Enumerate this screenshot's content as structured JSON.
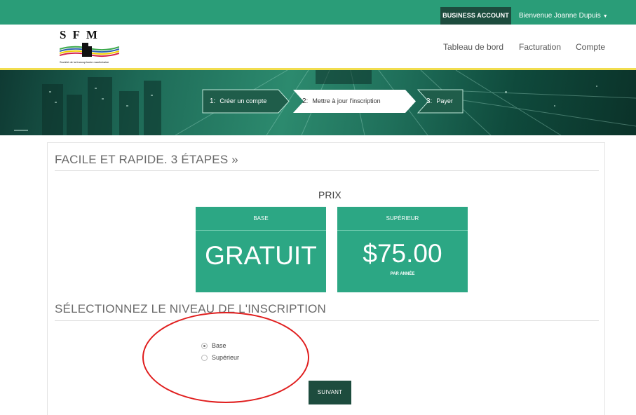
{
  "topbar": {
    "business_account": "BUSINESS ACCOUNT",
    "welcome": "Bienvenue Joanne Dupuis",
    "caret": "▼"
  },
  "logo": {
    "letters": "SFM",
    "subtitle": "Société de la francophonie manitobaine"
  },
  "nav": {
    "dashboard": "Tableau de bord",
    "billing": "Facturation",
    "account": "Compte"
  },
  "steps": [
    {
      "num": "1:",
      "label": "Créer un compte"
    },
    {
      "num": "2:",
      "label": "Mettre à jour l'inscription"
    },
    {
      "num": "3:",
      "label": "Payer"
    }
  ],
  "main": {
    "heading": "FACILE ET RAPIDE. 3 ÉTAPES »",
    "prix": "PRIX",
    "plans": [
      {
        "name": "BASE",
        "price": "GRATUIT",
        "sub": ""
      },
      {
        "name": "SUPÉRIEUR",
        "price": "$75.00",
        "sub": "PAR ANNÉE"
      }
    ],
    "select_heading": "SÉLECTIONNEZ LE NIVEAU DE L'INSCRIPTION",
    "options": [
      {
        "label": "Base",
        "checked": true
      },
      {
        "label": "Supérieur",
        "checked": false
      }
    ],
    "next_button": "SUIVANT"
  },
  "colors": {
    "brand_green": "#2a9d78",
    "dark_green": "#1d4c3e",
    "plan_green": "#2ca784",
    "accent_yellow": "#f1dd4f",
    "annotation_red": "#e01e1e"
  }
}
